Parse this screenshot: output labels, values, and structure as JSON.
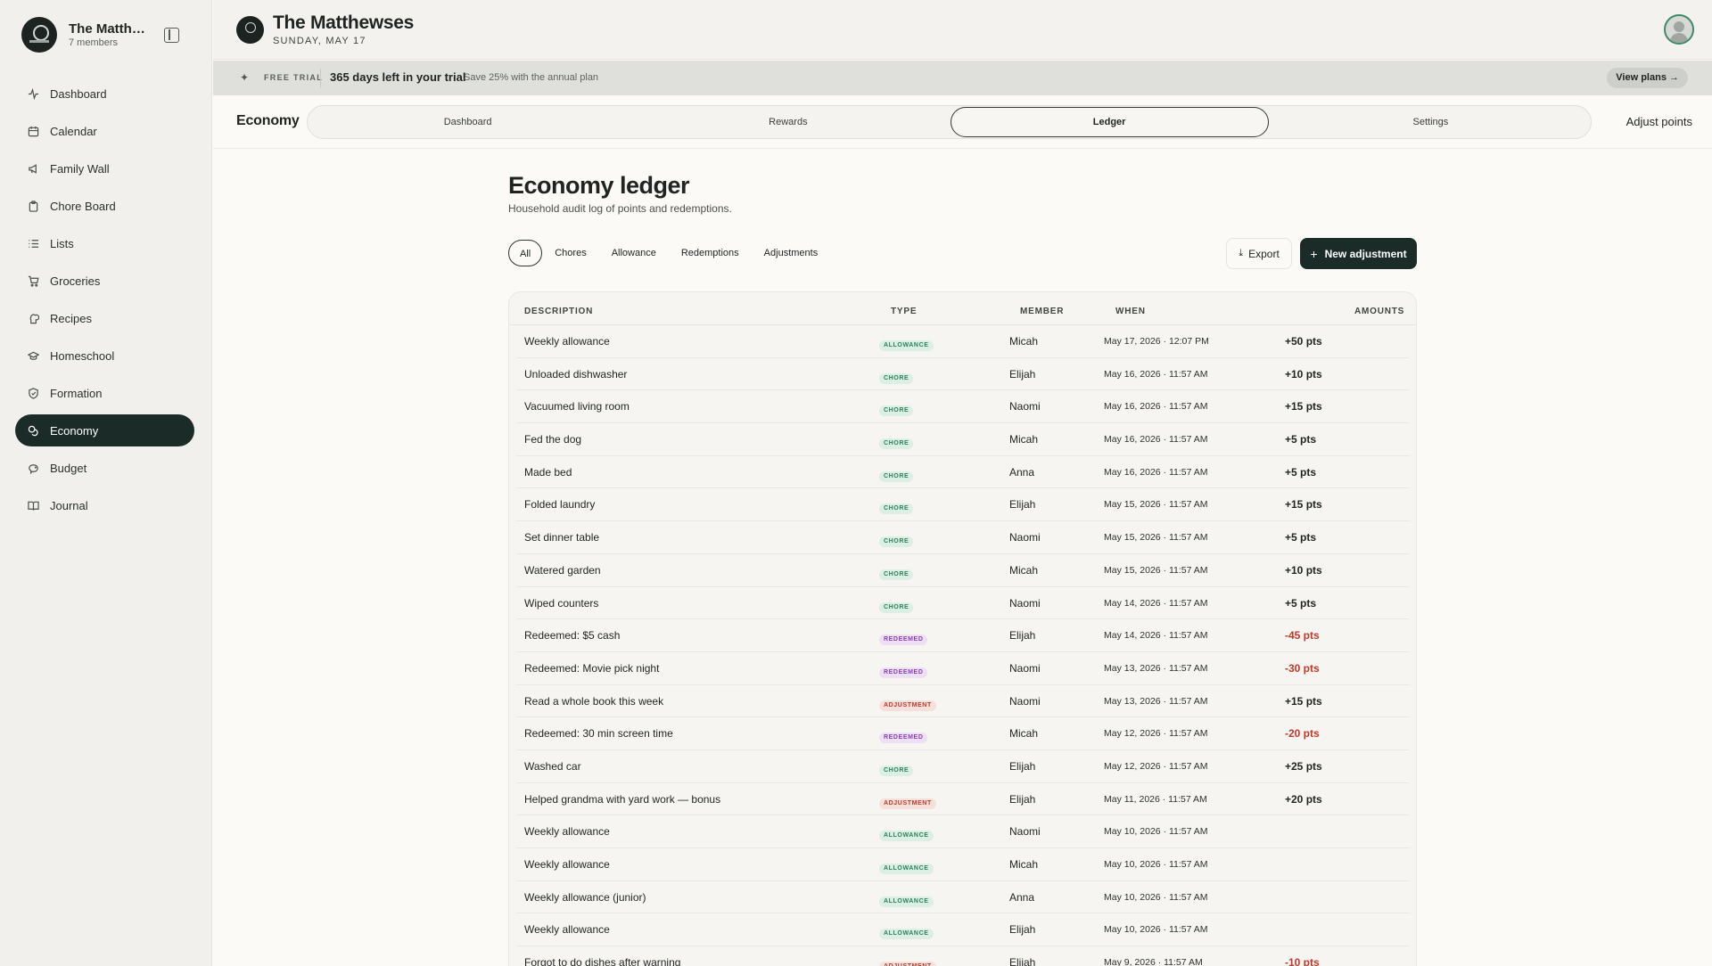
{
  "sidebar": {
    "family_name": "The Matthewses",
    "members": "7 members",
    "items": [
      {
        "label": "Dashboard",
        "icon": "activity-icon"
      },
      {
        "label": "Calendar",
        "icon": "calendar-icon"
      },
      {
        "label": "Family Wall",
        "icon": "megaphone-icon"
      },
      {
        "label": "Chore Board",
        "icon": "clipboard-icon"
      },
      {
        "label": "Lists",
        "icon": "list-icon"
      },
      {
        "label": "Groceries",
        "icon": "cart-icon"
      },
      {
        "label": "Recipes",
        "icon": "chef-hat-icon"
      },
      {
        "label": "Homeschool",
        "icon": "graduation-cap-icon"
      },
      {
        "label": "Formation",
        "icon": "shield-icon"
      },
      {
        "label": "Economy",
        "icon": "coins-icon",
        "active": true
      },
      {
        "label": "Budget",
        "icon": "piggy-bank-icon"
      },
      {
        "label": "Journal",
        "icon": "book-icon"
      }
    ]
  },
  "header": {
    "title": "The Matthewses",
    "date": "SUNDAY, MAY 17"
  },
  "trial": {
    "badge": "FREE TRIAL",
    "days": "365 days left in your trial",
    "save": "Save 25% with the annual plan",
    "cta": "View plans →"
  },
  "subnav": {
    "section": "Economy",
    "tabs": [
      "Dashboard",
      "Rewards",
      "Ledger",
      "Settings"
    ],
    "active_tab": "Ledger",
    "action": "Adjust points"
  },
  "main": {
    "title": "Economy ledger",
    "subtitle": "Household audit log of points and redemptions.",
    "filters": [
      "All",
      "Chores",
      "Allowance",
      "Redemptions",
      "Adjustments"
    ],
    "active_filter": "All",
    "export_label": "Export",
    "new_label": "New adjustment"
  },
  "table": {
    "headers": {
      "description": "DESCRIPTION",
      "type": "TYPE",
      "member": "MEMBER",
      "when": "WHEN",
      "amounts": "AMOUNTS"
    },
    "rows": [
      {
        "desc": "Weekly allowance",
        "type": "ALLOWANCE",
        "member": "Micah",
        "when": "May 17, 2026 · 12:07 PM",
        "amount": "+50 pts"
      },
      {
        "desc": "Unloaded dishwasher",
        "type": "CHORE",
        "member": "Elijah",
        "when": "May 16, 2026 · 11:57 AM",
        "amount": "+10 pts"
      },
      {
        "desc": "Vacuumed living room",
        "type": "CHORE",
        "member": "Naomi",
        "when": "May 16, 2026 · 11:57 AM",
        "amount": "+15 pts"
      },
      {
        "desc": "Fed the dog",
        "type": "CHORE",
        "member": "Micah",
        "when": "May 16, 2026 · 11:57 AM",
        "amount": "+5 pts"
      },
      {
        "desc": "Made bed",
        "type": "CHORE",
        "member": "Anna",
        "when": "May 16, 2026 · 11:57 AM",
        "amount": "+5 pts"
      },
      {
        "desc": "Folded laundry",
        "type": "CHORE",
        "member": "Elijah",
        "when": "May 15, 2026 · 11:57 AM",
        "amount": "+15 pts"
      },
      {
        "desc": "Set dinner table",
        "type": "CHORE",
        "member": "Naomi",
        "when": "May 15, 2026 · 11:57 AM",
        "amount": "+5 pts"
      },
      {
        "desc": "Watered garden",
        "type": "CHORE",
        "member": "Micah",
        "when": "May 15, 2026 · 11:57 AM",
        "amount": "+10 pts"
      },
      {
        "desc": "Wiped counters",
        "type": "CHORE",
        "member": "Naomi",
        "when": "May 14, 2026 · 11:57 AM",
        "amount": "+5 pts"
      },
      {
        "desc": "Redeemed: $5 cash",
        "type": "REDEEMED",
        "member": "Elijah",
        "when": "May 14, 2026 · 11:57 AM",
        "amount": "-45 pts"
      },
      {
        "desc": "Redeemed: Movie pick night",
        "type": "REDEEMED",
        "member": "Naomi",
        "when": "May 13, 2026 · 11:57 AM",
        "amount": "-30 pts"
      },
      {
        "desc": "Read a whole book this week",
        "type": "ADJUSTMENT",
        "member": "Naomi",
        "when": "May 13, 2026 · 11:57 AM",
        "amount": "+15 pts"
      },
      {
        "desc": "Redeemed: 30 min screen time",
        "type": "REDEEMED",
        "member": "Micah",
        "when": "May 12, 2026 · 11:57 AM",
        "amount": "-20 pts"
      },
      {
        "desc": "Washed car",
        "type": "CHORE",
        "member": "Elijah",
        "when": "May 12, 2026 · 11:57 AM",
        "amount": "+25 pts"
      },
      {
        "desc": "Helped grandma with yard work — bonus",
        "type": "ADJUSTMENT",
        "member": "Elijah",
        "when": "May 11, 2026 · 11:57 AM",
        "amount": "+20 pts"
      },
      {
        "desc": "Weekly allowance",
        "type": "ALLOWANCE",
        "member": "Naomi",
        "when": "May 10, 2026 · 11:57 AM",
        "amount": ""
      },
      {
        "desc": "Weekly allowance",
        "type": "ALLOWANCE",
        "member": "Micah",
        "when": "May 10, 2026 · 11:57 AM",
        "amount": ""
      },
      {
        "desc": "Weekly allowance (junior)",
        "type": "ALLOWANCE",
        "member": "Anna",
        "when": "May 10, 2026 · 11:57 AM",
        "amount": ""
      },
      {
        "desc": "Weekly allowance",
        "type": "ALLOWANCE",
        "member": "Elijah",
        "when": "May 10, 2026 · 11:57 AM",
        "amount": ""
      },
      {
        "desc": "Forgot to do dishes after warning",
        "type": "ADJUSTMENT",
        "member": "Elijah",
        "when": "May 9, 2026 · 11:57 AM",
        "amount": "-10 pts"
      }
    ]
  },
  "colors": {
    "accent": "#1b2b28",
    "negative": "#c0392b",
    "chore": "#2f8058",
    "redeemed": "#8b3fb8"
  }
}
